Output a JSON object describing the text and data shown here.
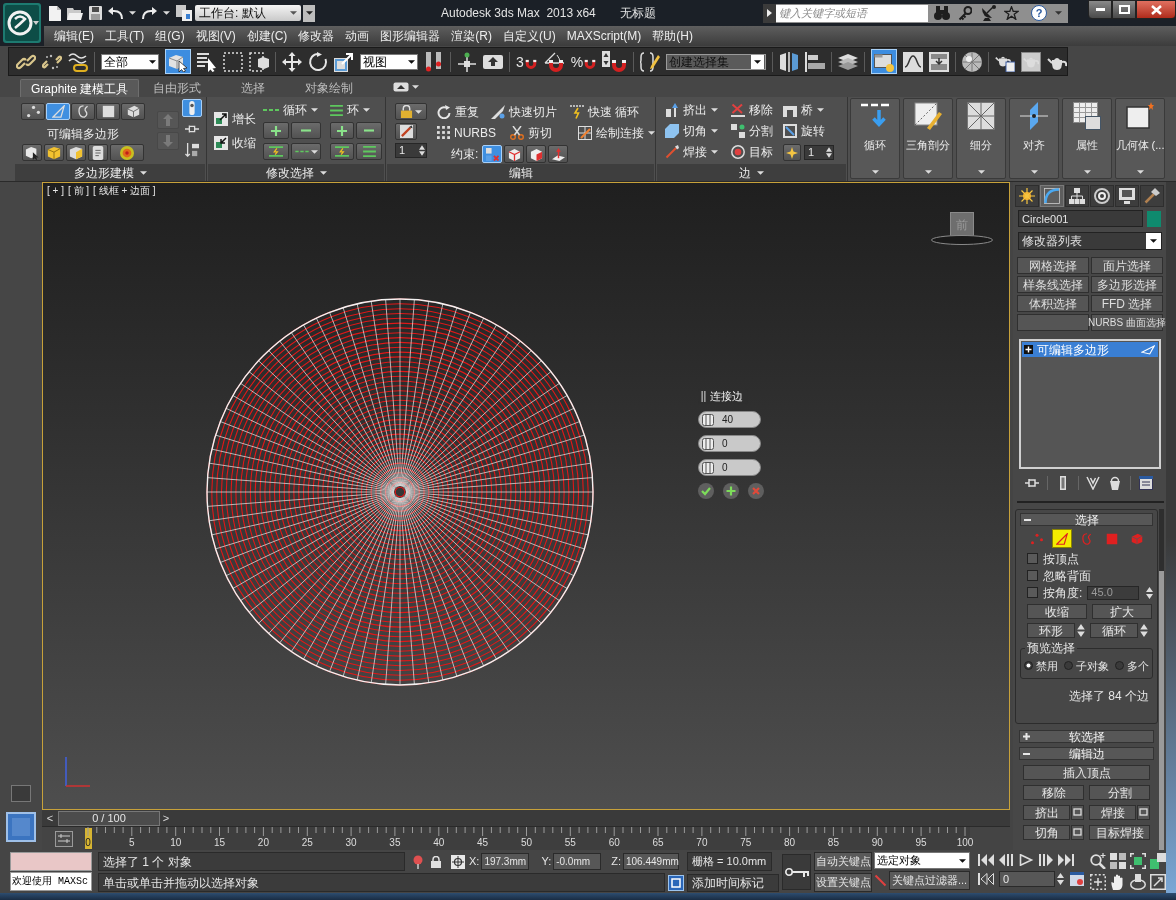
{
  "title_bar": {
    "workspace": "工作台: 默认",
    "app_title": "Autodesk 3ds Max  2013 x64",
    "document_title": "无标题",
    "search": {
      "placeholder": "键入关键字或短语"
    },
    "help": "?"
  },
  "menu_bar": [
    "编辑(E)",
    "工具(T)",
    "组(G)",
    "视图(V)",
    "创建(C)",
    "修改器",
    "动画",
    "图形编辑器",
    "渲染(R)",
    "自定义(U)",
    "MAXScript(M)",
    "帮助(H)"
  ],
  "main_toolbar": {
    "selection_filter": "全部",
    "select_object_on": true,
    "reference_coordinate_system": "视图",
    "snap_toggle": "3",
    "percent_snap": "%",
    "named_selection_set": {
      "placeholder": "创建选择集"
    },
    "ribbon_toggle_on": true
  },
  "ribbon": {
    "tabs": [
      {
        "label": "Graphite 建模工具",
        "selected": true
      },
      {
        "label": "自由形式",
        "selected": false
      },
      {
        "label": "选择",
        "selected": false
      },
      {
        "label": "对象绘制",
        "selected": false
      }
    ],
    "polygon_modeling": {
      "title": "多边形建模",
      "title_menu": true,
      "subobjects": [
        {
          "selected": false
        },
        {
          "selected": true
        },
        {
          "selected": false
        },
        {
          "selected": false
        },
        {
          "selected": false
        }
      ],
      "object_type": "可编辑多边形",
      "modifier_nav": [
        {
          "disabled": true
        },
        {
          "disabled": true
        }
      ],
      "side_toggles": [
        {
          "on": true
        },
        {
          "on": false
        },
        {
          "on": false
        }
      ]
    },
    "modify_selection": {
      "title": "修改选择",
      "title_menu": true,
      "grow": "增长",
      "shrink": "收缩",
      "loop": "循环",
      "ring": "环"
    },
    "edit": {
      "title": "编辑",
      "title_menu": false,
      "spinner": "1",
      "repeat": "重复",
      "nurbs": "NURBS",
      "constraints_label": "约束:",
      "constraints": [
        {
          "selected": true
        },
        {
          "selected": false
        },
        {
          "selected": false
        },
        {
          "selected": false
        }
      ],
      "quick_slice": "快速切片",
      "cut": "剪切",
      "swift_loop": "快速 循环",
      "paint_connect": "绘制连接"
    },
    "edges": {
      "title": "边",
      "title_menu": true,
      "columns": [
        [
          {
            "label": "挤出",
            "dropdown": true
          },
          {
            "label": "切角",
            "dropdown": true
          },
          {
            "label": "焊接",
            "dropdown": true
          }
        ],
        [
          {
            "label": "移除",
            "dropdown": false
          },
          {
            "label": "分割",
            "dropdown": false
          },
          {
            "label": "目标",
            "dropdown": false
          }
        ],
        [
          {
            "label": "桥",
            "dropdown": true
          },
          {
            "label": "旋转",
            "dropdown": false
          }
        ]
      ],
      "spinner": "1"
    },
    "large_buttons": [
      "循环",
      "三角剖分",
      "细分",
      "对齐",
      "属性",
      "几何体 (..."
    ]
  },
  "viewport": {
    "labels": [
      "[ + ]",
      "[ 前 ]",
      "[ 线框 + 边面 ]"
    ],
    "viewcube_face": "前",
    "caddy": {
      "title": "连接边",
      "values": [
        "40",
        "0",
        "0"
      ]
    }
  },
  "time_slider": {
    "previous": "<",
    "position": "0 / 100",
    "next": ">"
  },
  "track_bar": {
    "labels": [
      "0",
      "5",
      "10",
      "15",
      "20",
      "25",
      "30",
      "35",
      "40",
      "45",
      "50",
      "55",
      "60",
      "65",
      "70",
      "75",
      "80",
      "85",
      "90",
      "95",
      "100"
    ]
  },
  "command_panel": {
    "tabs": [
      {
        "selected": false
      },
      {
        "selected": true
      },
      {
        "selected": false
      },
      {
        "selected": false
      },
      {
        "selected": false
      },
      {
        "selected": false
      }
    ],
    "object": {
      "name": "Circle001",
      "color": "#0f8a6e"
    },
    "modifier_list": "修改器列表",
    "modifier_buttons": [
      {
        "kind": "button",
        "label": "网格选择"
      },
      {
        "kind": "button",
        "label": "面片选择"
      },
      {
        "kind": "button",
        "label": "样条线选择"
      },
      {
        "kind": "button",
        "label": "多边形选择"
      },
      {
        "kind": "button",
        "label": "体积选择"
      },
      {
        "kind": "button",
        "label": "FFD 选择"
      },
      {
        "kind": "blank"
      },
      {
        "kind": "button",
        "label": "NURBS 曲面选择"
      }
    ],
    "modifier_stack": [
      {
        "label": "可编辑多边形",
        "selected": true
      }
    ],
    "selection_rollout": {
      "title": "选择",
      "expanded": true,
      "subobjects": [
        {
          "selected": false
        },
        {
          "selected": true
        },
        {
          "selected": false
        },
        {
          "selected": false
        },
        {
          "selected": false
        }
      ],
      "checkboxes": [
        {
          "label": "按顶点",
          "checked": false
        },
        {
          "label": "忽略背面",
          "checked": false
        },
        {
          "label": "按角度:",
          "checked": false,
          "value": "45.0"
        }
      ],
      "shrink": "收缩",
      "grow": "扩大",
      "ring": "环形",
      "loop": "循环",
      "preview": {
        "title": "预览选择",
        "options": [
          {
            "label": "禁用",
            "selected": true
          },
          {
            "label": "子对象",
            "selected": false
          },
          {
            "label": "多个",
            "selected": false
          }
        ]
      },
      "status": "选择了 84 个边"
    },
    "soft_selection_rollout": {
      "title": "软选择",
      "expanded": false
    },
    "edit_edges_rollout": {
      "title": "编辑边",
      "expanded": true,
      "rows": [
        [
          {
            "label": "插入顶点",
            "settings": false
          }
        ],
        [
          {
            "label": "移除",
            "settings": false
          },
          {
            "label": "分割",
            "settings": false
          }
        ],
        [
          {
            "label": "挤出",
            "settings": true
          },
          {
            "label": "焊接",
            "settings": true
          }
        ],
        [
          {
            "label": "切角",
            "settings": true
          },
          {
            "label": "目标焊接",
            "settings": false
          }
        ]
      ]
    }
  },
  "status_bar": {
    "listener_output": "欢迎使用 MAXSc",
    "prompt": "选择了 1 个 对象",
    "hint": "单击或单击并拖动以选择对象",
    "coordinates": [
      {
        "axis": "X:",
        "value": "197.3mm"
      },
      {
        "axis": "Y:",
        "value": "-0.0mm"
      },
      {
        "axis": "Z:",
        "value": "106.449mm"
      }
    ],
    "grid": "栅格 = 10.0mm",
    "time_tag": "添加时间标记",
    "auto_key": "自动关键点",
    "set_key": "设置关键点",
    "key_target": "选定对象",
    "key_filters": "关键点过滤器...",
    "frame": "0"
  }
}
